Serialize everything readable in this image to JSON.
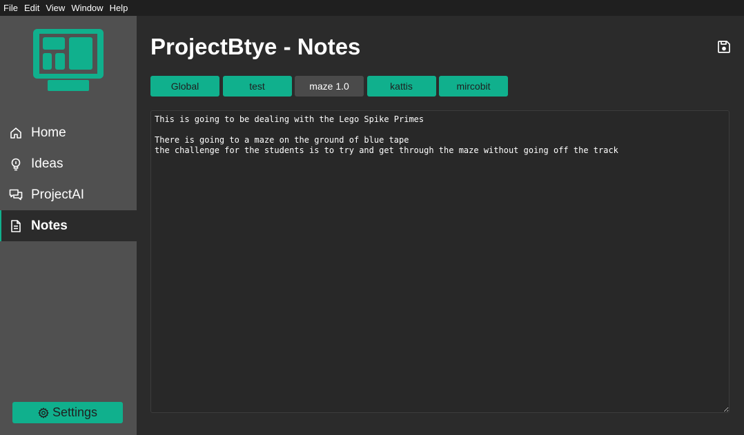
{
  "menubar": {
    "items": [
      "File",
      "Edit",
      "View",
      "Window",
      "Help"
    ]
  },
  "sidebar": {
    "logo_icon": "monitor-dashboard-icon",
    "items": [
      {
        "label": "Home",
        "icon": "home-icon"
      },
      {
        "label": "Ideas",
        "icon": "lightbulb-icon"
      },
      {
        "label": "ProjectAI",
        "icon": "chat-icon"
      },
      {
        "label": "Notes",
        "icon": "document-icon",
        "active": true
      }
    ],
    "settings_label": "Settings"
  },
  "main": {
    "title": "ProjectBtye - Notes",
    "save_icon": "save-icon",
    "tabs": [
      {
        "label": "Global"
      },
      {
        "label": "test"
      },
      {
        "label": "maze 1.0",
        "active": true
      },
      {
        "label": "kattis"
      },
      {
        "label": "mircobit"
      }
    ],
    "note_content": "This is going to be dealing with the Lego Spike Primes\n\nThere is going to a maze on the ground of blue tape\nthe challenge for the students is to try and get through the maze without going off the track"
  },
  "colors": {
    "accent": "#10b08d",
    "sidebar_bg": "#505050",
    "main_bg": "#2b2b2b",
    "menubar_bg": "#1f1f1f"
  }
}
